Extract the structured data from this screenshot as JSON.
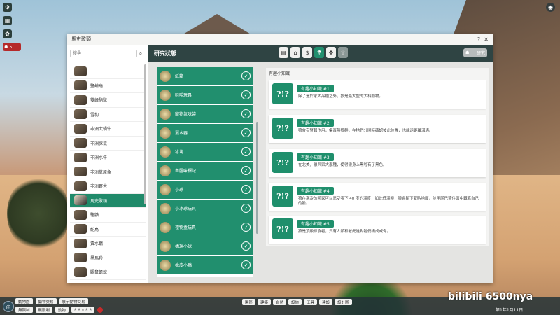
{
  "window": {
    "title": "馬吏歌頭"
  },
  "search": {
    "placeholder": "搜尋"
  },
  "animals": [
    {
      "name": ""
    },
    {
      "name": "鹽鹼龜"
    },
    {
      "name": "雙峰駱駝"
    },
    {
      "name": "雪豹"
    },
    {
      "name": "非洲大蝸牛"
    },
    {
      "name": "非洲豚鼠"
    },
    {
      "name": "非洲水牛"
    },
    {
      "name": "非洲草原象"
    },
    {
      "name": "非洲野犬"
    },
    {
      "name": "馬吏歌頭",
      "selected": true
    },
    {
      "name": "駱鼬"
    },
    {
      "name": "鴕鳥"
    },
    {
      "name": "黃水鵝"
    },
    {
      "name": "黑馬羚"
    },
    {
      "name": "鼴鼠蟾蛇"
    }
  ],
  "research": {
    "title": "研究狀態",
    "tabs": [
      "habitat-icon",
      "gift-icon",
      "money-icon",
      "enrichment-icon",
      "paw-icon",
      "trophy-icon"
    ],
    "button": "研究"
  },
  "enrichment": [
    {
      "label": "紙箱"
    },
    {
      "label": "咀嚼玩具"
    },
    {
      "label": "寵物氣味袋"
    },
    {
      "label": "灑水器"
    },
    {
      "label": "冰塊"
    },
    {
      "label": "血腥味標記"
    },
    {
      "label": "小球"
    },
    {
      "label": "小冰球玩具"
    },
    {
      "label": "禮物盒玩具"
    },
    {
      "label": "構球小球"
    },
    {
      "label": "橡皮小鴨"
    }
  ],
  "trivia": {
    "heading": "有趣小知識",
    "facts": [
      {
        "title": "有趣小知識 #1",
        "text": "除了是於家犬品種之外，狼是最大型的犬科動物。"
      },
      {
        "title": "有趣小知識 #2",
        "text": "狼會有警報作用，集百無狼群，在牠們分開時確認彼此位置，也能遠距離溝通。"
      },
      {
        "title": "有趣小知識 #3",
        "text": "在北美，狼與家犬混種，使得狼身上黑啦有了黑色。"
      },
      {
        "title": "有趣小知識 #4",
        "text": "狼在寒冷的國家可以忍受零下 40 度的溫度，如此低溫時，狼會躺下緊貼地面，並用尾巴蓋住面中鐵寫自己的臉。"
      },
      {
        "title": "有趣小知識 #5",
        "text": "狼是頂級掠食者，只有人類和老虎進對牠們構成威脅。"
      }
    ]
  },
  "hud": {
    "alert_count": "5",
    "bottom_left_chips": [
      "動物園",
      "動物交易",
      "展示動物交易"
    ],
    "bottom_left_row2": [
      "無限制",
      "無限制",
      "動物"
    ],
    "bottom_center": [
      "園區",
      "建築",
      "自然",
      "設施",
      "工具",
      "建設",
      "設計圖"
    ],
    "date": "第1年1月11日",
    "watermark": "bilibili 6500nya"
  }
}
